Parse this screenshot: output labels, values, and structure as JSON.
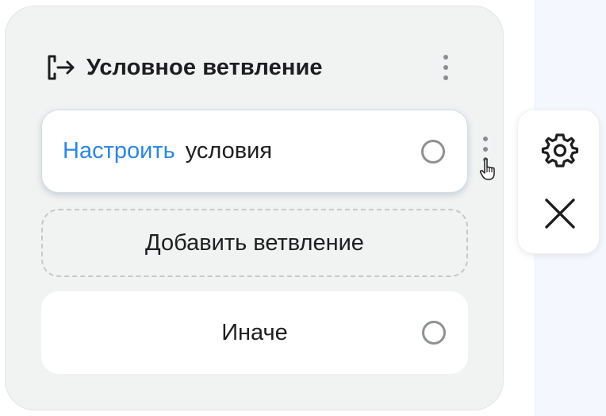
{
  "node": {
    "title": "Условное ветвление",
    "icon": "branch-exit-icon",
    "menu_icon": "more-vertical-icon"
  },
  "rows": {
    "condition": {
      "link_label": "Настроить",
      "text": "условия"
    },
    "add_branch": {
      "label": "Добавить ветвление"
    },
    "else": {
      "label": "Иначе"
    }
  },
  "toolbar": {
    "settings_icon": "gear-icon",
    "close_icon": "close-icon"
  },
  "colors": {
    "accent": "#2e86de",
    "card_bg": "#f1f2f2",
    "canvas_bg": "#f4f7fd"
  }
}
